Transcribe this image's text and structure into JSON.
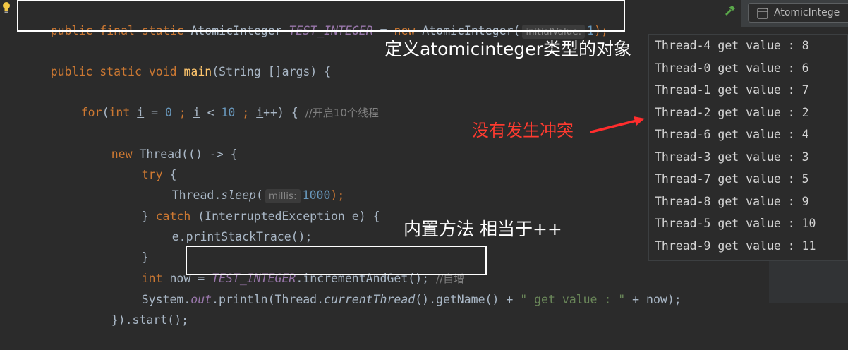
{
  "editor": {
    "line1": {
      "kw1": "public final static ",
      "type": "AtomicInteger ",
      "const": "TEST_INTEGER",
      "op": " = ",
      "kw_new": "new ",
      "ctor": "AtomicInteger(",
      "hint": "initialValue:",
      "num": "1",
      "end": ");"
    },
    "line2": {
      "kw": "public static void ",
      "method": "main",
      "rest": "(String []args) {"
    },
    "line3": {
      "kw": "for",
      "p1": "(",
      "kw_int": "int ",
      "i1": "i",
      "eq": " = ",
      "n0": "0",
      "semi1": " ; ",
      "i2": "i",
      "lt": " < ",
      "n10": "10",
      "semi2": " ; ",
      "i3": "i",
      "inc": "++) { ",
      "comment": "//开启10个线程"
    },
    "line4": {
      "kw": "new ",
      "rest": "Thread(() -> {"
    },
    "line5": {
      "kw": "try",
      "rest": " {"
    },
    "line6": {
      "cls": "Thread.",
      "method": "sleep",
      "p": "(",
      "hint": "millis:",
      "num": "1000",
      "end": ");"
    },
    "line7": {
      "brace": "} ",
      "kw": "catch",
      "rest": " (InterruptedException e) {"
    },
    "line8": {
      "text": "e.printStackTrace();"
    },
    "line9": {
      "text": "}"
    },
    "line10": {
      "kw": "int ",
      "var": "now = ",
      "const": "TEST_INTEGER",
      "rest": ".incrementAndGet(); ",
      "comment": "//自增"
    },
    "line11": {
      "pre": "System.",
      "field": "out",
      "mid": ".println(Thread.",
      "method": "currentThread",
      "mid2": "().getName() + ",
      "str": "\" get value : \"",
      "end": " + now);"
    },
    "line12": {
      "text": "}).start();"
    }
  },
  "annotations": {
    "define": "定义atomicinteger类型的对象",
    "no_conflict": "没有发生冲突",
    "builtin": "内置方法 相当于++"
  },
  "console": {
    "lines": [
      "Thread-4 get value : 8",
      "Thread-0 get value : 6",
      "Thread-1 get value : 7",
      "Thread-2 get value : 2",
      "Thread-6 get value : 4",
      "Thread-3 get value : 3",
      "Thread-7 get value : 5",
      "Thread-8 get value : 9",
      "Thread-5 get value : 10",
      "Thread-9 get value : 11"
    ]
  },
  "tab": {
    "label": "AtomicIntege"
  },
  "colors": {
    "annotation_red": "#ff3b30",
    "box_border": "#ffffff",
    "background": "#2b2b2b"
  },
  "icons": [
    "lightbulb-icon",
    "hammer-icon",
    "file-icon",
    "arrow-icon"
  ]
}
